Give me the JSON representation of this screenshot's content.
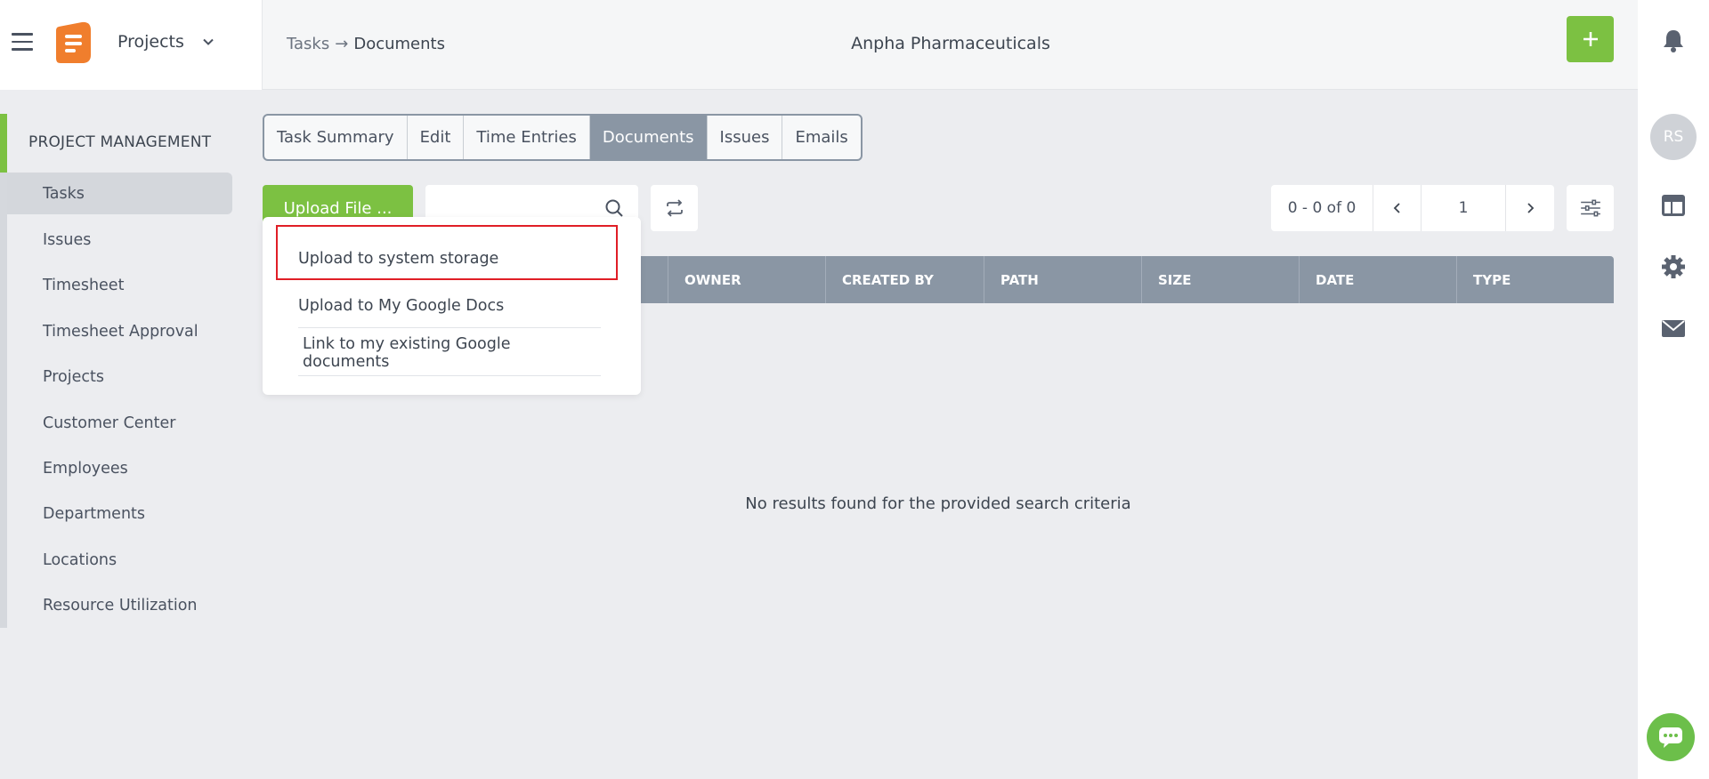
{
  "header": {
    "project_switch_label": "Projects",
    "breadcrumb": {
      "parent": "Tasks",
      "separator": "→",
      "current": "Documents"
    },
    "company": "Anpha Pharmaceuticals",
    "add_symbol": "+"
  },
  "rail": {
    "avatar_initials": "RS"
  },
  "sidebar": {
    "section_title": "PROJECT MANAGEMENT",
    "items": [
      {
        "label": "Tasks",
        "active": true
      },
      {
        "label": "Issues"
      },
      {
        "label": "Timesheet"
      },
      {
        "label": "Timesheet Approval"
      },
      {
        "label": "Projects"
      },
      {
        "label": "Customer Center"
      },
      {
        "label": "Employees"
      },
      {
        "label": "Departments"
      },
      {
        "label": "Locations"
      },
      {
        "label": "Resource Utilization"
      }
    ]
  },
  "tabs": [
    {
      "label": "Task Summary"
    },
    {
      "label": "Edit"
    },
    {
      "label": "Time Entries"
    },
    {
      "label": "Documents",
      "active": true
    },
    {
      "label": "Issues"
    },
    {
      "label": "Emails"
    }
  ],
  "toolbar": {
    "upload_label": "Upload File ...",
    "search_value": "",
    "pager_count": "0 - 0 of 0",
    "page_number": "1"
  },
  "table": {
    "columns": [
      "OWNER",
      "CREATED BY",
      "PATH",
      "SIZE",
      "DATE",
      "TYPE"
    ],
    "empty_message": "No results found for the provided search criteria"
  },
  "dropdown": {
    "items": [
      {
        "label": "Upload to system storage",
        "highlighted": true
      },
      {
        "label": "Upload to My Google Docs"
      },
      {
        "label": "Link to my existing Google documents"
      }
    ]
  },
  "colors": {
    "brand_green": "#7cc142",
    "logo_orange": "#f07e2d",
    "table_header": "#8a96a4",
    "highlight_red": "#e01e26"
  }
}
